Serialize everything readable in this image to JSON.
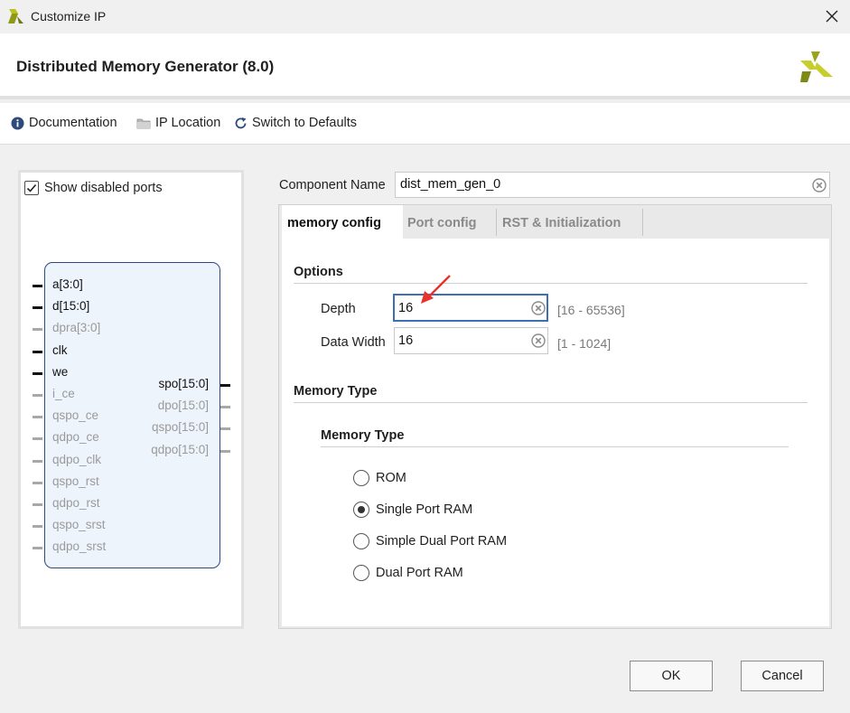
{
  "window": {
    "title": "Customize IP",
    "app_icon": "vivado-logo-icon",
    "close_icon": "close-icon"
  },
  "header": {
    "title": "Distributed Memory Generator (8.0)",
    "logo_icon": "xilinx-logo-icon"
  },
  "toolbar": {
    "documentation_label": "Documentation",
    "documentation_icon": "info-icon",
    "ip_location_label": "IP Location",
    "ip_location_icon": "folder-icon",
    "switch_defaults_label": "Switch to Defaults",
    "switch_defaults_icon": "refresh-icon"
  },
  "symbol_panel": {
    "show_disabled_ports_label": "Show disabled ports",
    "show_disabled_ports_checked": true,
    "input_ports": [
      {
        "name": "a[3:0]",
        "enabled": true
      },
      {
        "name": "d[15:0]",
        "enabled": true
      },
      {
        "name": "dpra[3:0]",
        "enabled": false
      },
      {
        "name": "clk",
        "enabled": true
      },
      {
        "name": "we",
        "enabled": true
      },
      {
        "name": "i_ce",
        "enabled": false
      },
      {
        "name": "qspo_ce",
        "enabled": false
      },
      {
        "name": "qdpo_ce",
        "enabled": false
      },
      {
        "name": "qdpo_clk",
        "enabled": false
      },
      {
        "name": "qspo_rst",
        "enabled": false
      },
      {
        "name": "qdpo_rst",
        "enabled": false
      },
      {
        "name": "qspo_srst",
        "enabled": false
      },
      {
        "name": "qdpo_srst",
        "enabled": false
      }
    ],
    "output_ports": [
      {
        "name": "spo[15:0]",
        "enabled": true
      },
      {
        "name": "dpo[15:0]",
        "enabled": false
      },
      {
        "name": "qspo[15:0]",
        "enabled": false
      },
      {
        "name": "qdpo[15:0]",
        "enabled": false
      }
    ]
  },
  "config": {
    "component_name_label": "Component Name",
    "component_name_value": "dist_mem_gen_0",
    "tabs": [
      {
        "label": "memory config",
        "active": true
      },
      {
        "label": "Port config",
        "active": false
      },
      {
        "label": "RST & Initialization",
        "active": false
      }
    ],
    "options_title": "Options",
    "depth_label": "Depth",
    "depth_value": "16",
    "depth_range": "[16 - 65536]",
    "data_width_label": "Data Width",
    "data_width_value": "16",
    "data_width_range": "[1 - 1024]",
    "memory_type_section_title": "Memory Type",
    "memory_type_group_title": "Memory Type",
    "memory_types": [
      {
        "label": "ROM",
        "selected": false
      },
      {
        "label": "Single Port RAM",
        "selected": true
      },
      {
        "label": "Simple Dual Port RAM",
        "selected": false
      },
      {
        "label": "Dual Port RAM",
        "selected": false
      }
    ]
  },
  "footer": {
    "ok_label": "OK",
    "cancel_label": "Cancel"
  },
  "colors": {
    "focus_border": "#3d6fb5",
    "annotation_arrow": "#e8322c",
    "logo_yellow": "#b8c21a",
    "logo_olive": "#6f7a12"
  }
}
